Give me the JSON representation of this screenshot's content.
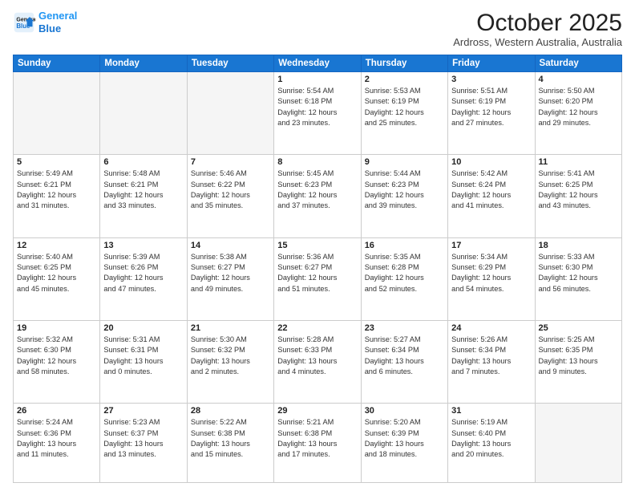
{
  "header": {
    "logo_line1": "General",
    "logo_line2": "Blue",
    "title": "October 2025",
    "location": "Ardross, Western Australia, Australia"
  },
  "days_of_week": [
    "Sunday",
    "Monday",
    "Tuesday",
    "Wednesday",
    "Thursday",
    "Friday",
    "Saturday"
  ],
  "weeks": [
    [
      {
        "day": "",
        "info": ""
      },
      {
        "day": "",
        "info": ""
      },
      {
        "day": "",
        "info": ""
      },
      {
        "day": "1",
        "info": "Sunrise: 5:54 AM\nSunset: 6:18 PM\nDaylight: 12 hours\nand 23 minutes."
      },
      {
        "day": "2",
        "info": "Sunrise: 5:53 AM\nSunset: 6:19 PM\nDaylight: 12 hours\nand 25 minutes."
      },
      {
        "day": "3",
        "info": "Sunrise: 5:51 AM\nSunset: 6:19 PM\nDaylight: 12 hours\nand 27 minutes."
      },
      {
        "day": "4",
        "info": "Sunrise: 5:50 AM\nSunset: 6:20 PM\nDaylight: 12 hours\nand 29 minutes."
      }
    ],
    [
      {
        "day": "5",
        "info": "Sunrise: 5:49 AM\nSunset: 6:21 PM\nDaylight: 12 hours\nand 31 minutes."
      },
      {
        "day": "6",
        "info": "Sunrise: 5:48 AM\nSunset: 6:21 PM\nDaylight: 12 hours\nand 33 minutes."
      },
      {
        "day": "7",
        "info": "Sunrise: 5:46 AM\nSunset: 6:22 PM\nDaylight: 12 hours\nand 35 minutes."
      },
      {
        "day": "8",
        "info": "Sunrise: 5:45 AM\nSunset: 6:23 PM\nDaylight: 12 hours\nand 37 minutes."
      },
      {
        "day": "9",
        "info": "Sunrise: 5:44 AM\nSunset: 6:23 PM\nDaylight: 12 hours\nand 39 minutes."
      },
      {
        "day": "10",
        "info": "Sunrise: 5:42 AM\nSunset: 6:24 PM\nDaylight: 12 hours\nand 41 minutes."
      },
      {
        "day": "11",
        "info": "Sunrise: 5:41 AM\nSunset: 6:25 PM\nDaylight: 12 hours\nand 43 minutes."
      }
    ],
    [
      {
        "day": "12",
        "info": "Sunrise: 5:40 AM\nSunset: 6:25 PM\nDaylight: 12 hours\nand 45 minutes."
      },
      {
        "day": "13",
        "info": "Sunrise: 5:39 AM\nSunset: 6:26 PM\nDaylight: 12 hours\nand 47 minutes."
      },
      {
        "day": "14",
        "info": "Sunrise: 5:38 AM\nSunset: 6:27 PM\nDaylight: 12 hours\nand 49 minutes."
      },
      {
        "day": "15",
        "info": "Sunrise: 5:36 AM\nSunset: 6:27 PM\nDaylight: 12 hours\nand 51 minutes."
      },
      {
        "day": "16",
        "info": "Sunrise: 5:35 AM\nSunset: 6:28 PM\nDaylight: 12 hours\nand 52 minutes."
      },
      {
        "day": "17",
        "info": "Sunrise: 5:34 AM\nSunset: 6:29 PM\nDaylight: 12 hours\nand 54 minutes."
      },
      {
        "day": "18",
        "info": "Sunrise: 5:33 AM\nSunset: 6:30 PM\nDaylight: 12 hours\nand 56 minutes."
      }
    ],
    [
      {
        "day": "19",
        "info": "Sunrise: 5:32 AM\nSunset: 6:30 PM\nDaylight: 12 hours\nand 58 minutes."
      },
      {
        "day": "20",
        "info": "Sunrise: 5:31 AM\nSunset: 6:31 PM\nDaylight: 13 hours\nand 0 minutes."
      },
      {
        "day": "21",
        "info": "Sunrise: 5:30 AM\nSunset: 6:32 PM\nDaylight: 13 hours\nand 2 minutes."
      },
      {
        "day": "22",
        "info": "Sunrise: 5:28 AM\nSunset: 6:33 PM\nDaylight: 13 hours\nand 4 minutes."
      },
      {
        "day": "23",
        "info": "Sunrise: 5:27 AM\nSunset: 6:34 PM\nDaylight: 13 hours\nand 6 minutes."
      },
      {
        "day": "24",
        "info": "Sunrise: 5:26 AM\nSunset: 6:34 PM\nDaylight: 13 hours\nand 7 minutes."
      },
      {
        "day": "25",
        "info": "Sunrise: 5:25 AM\nSunset: 6:35 PM\nDaylight: 13 hours\nand 9 minutes."
      }
    ],
    [
      {
        "day": "26",
        "info": "Sunrise: 5:24 AM\nSunset: 6:36 PM\nDaylight: 13 hours\nand 11 minutes."
      },
      {
        "day": "27",
        "info": "Sunrise: 5:23 AM\nSunset: 6:37 PM\nDaylight: 13 hours\nand 13 minutes."
      },
      {
        "day": "28",
        "info": "Sunrise: 5:22 AM\nSunset: 6:38 PM\nDaylight: 13 hours\nand 15 minutes."
      },
      {
        "day": "29",
        "info": "Sunrise: 5:21 AM\nSunset: 6:38 PM\nDaylight: 13 hours\nand 17 minutes."
      },
      {
        "day": "30",
        "info": "Sunrise: 5:20 AM\nSunset: 6:39 PM\nDaylight: 13 hours\nand 18 minutes."
      },
      {
        "day": "31",
        "info": "Sunrise: 5:19 AM\nSunset: 6:40 PM\nDaylight: 13 hours\nand 20 minutes."
      },
      {
        "day": "",
        "info": ""
      }
    ]
  ]
}
